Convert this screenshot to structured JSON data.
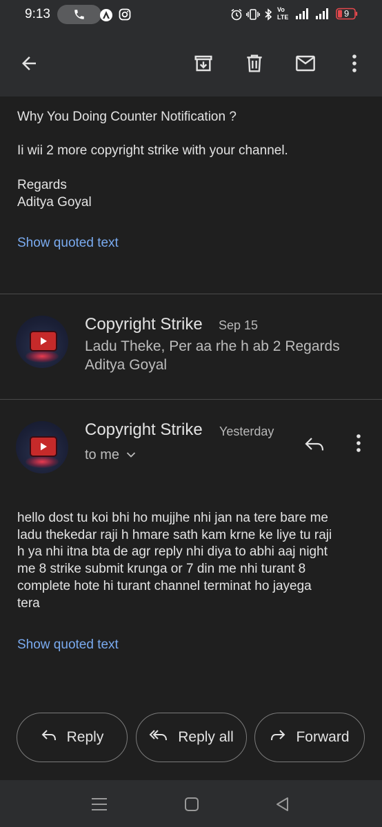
{
  "status_bar": {
    "time": "9:13",
    "battery_level": "9",
    "icons": [
      "phone-call-icon",
      "anchor-app-icon",
      "instagram-icon",
      "alarm-icon",
      "vibrate-icon",
      "bluetooth-icon",
      "volte-icon",
      "signal-icon",
      "signal-icon-2",
      "battery-icon"
    ],
    "volte_label_top": "Vo",
    "volte_label_bottom": "LTE"
  },
  "toolbar": {
    "icons": [
      "back-arrow-icon",
      "archive-icon",
      "delete-icon",
      "mark-unread-icon",
      "more-vert-icon"
    ]
  },
  "message_1": {
    "lines": [
      "Why You Doing Counter Notification ?",
      "Ii wii 2 more copyright strike with your channel.",
      "Regards",
      "Aditya Goyal"
    ],
    "show_quoted": "Show quoted text"
  },
  "message_2": {
    "sender": "Copyright Strike",
    "date": "Sep 15",
    "snippet_line1": "Ladu Theke, Per aa rhe h ab 2 Regards",
    "snippet_line2": "Aditya Goyal"
  },
  "message_3": {
    "sender": "Copyright Strike",
    "date": "Yesterday",
    "recipient": "to me",
    "body_lines": [
      "hello dost tu koi bhi ho mujjhe nhi jan na tere bare me",
      "ladu thekedar raji h hmare sath kam krne ke liye tu raji",
      "h ya nhi itna bta de agr reply nhi diya to abhi aaj night",
      "me 8 strike submit krunga or 7 din me nhi turant 8",
      "complete hote hi turant channel terminat ho jayega",
      "tera"
    ],
    "show_quoted": "Show quoted text"
  },
  "actions": {
    "reply": "Reply",
    "reply_all": "Reply all",
    "forward": "Forward"
  },
  "colors": {
    "background": "#1f1f1f",
    "bar": "#2c2d2f",
    "link": "#7aabf0",
    "text": "#e3e3e3",
    "battery_red": "#e5484d"
  }
}
